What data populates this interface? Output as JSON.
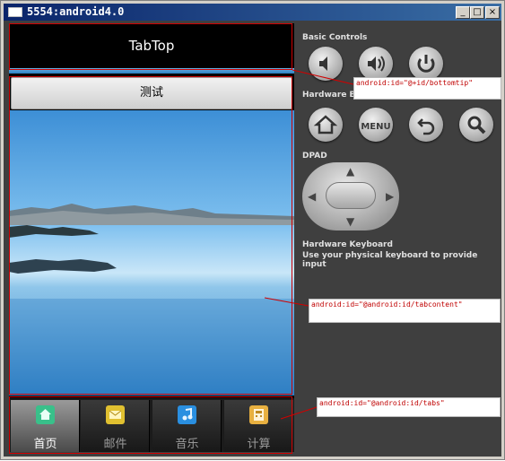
{
  "window": {
    "title": "5554:android4.0",
    "minimize_label": "_",
    "maximize_label": "□",
    "close_label": "×"
  },
  "app": {
    "header": "TabTop",
    "button_label": "测试",
    "tabs": [
      {
        "label": "首页",
        "icon": "home-icon",
        "color": "#39c08a",
        "selected": true
      },
      {
        "label": "邮件",
        "icon": "mail-icon",
        "color": "#e0c030",
        "selected": false
      },
      {
        "label": "音乐",
        "icon": "music-icon",
        "color": "#2a8fe0",
        "selected": false
      },
      {
        "label": "计算",
        "icon": "calculator-icon",
        "color": "#e8b040",
        "selected": false
      }
    ]
  },
  "emulator": {
    "basic_controls": "Basic Controls",
    "hardware_buttons": "Hardware Butt",
    "dpad": "DPAD",
    "keyboard_title": "Hardware Keyboard",
    "keyboard_text": "Use your physical keyboard to provide input",
    "menu_label": "MENU"
  },
  "annotations": {
    "bottomtip": "android:id=\"@+id/bottomtip\"",
    "tabcontent": "android:id=\"@android:id/tabcontent\"",
    "tabs": "android:id=\"@android:id/tabs\""
  }
}
